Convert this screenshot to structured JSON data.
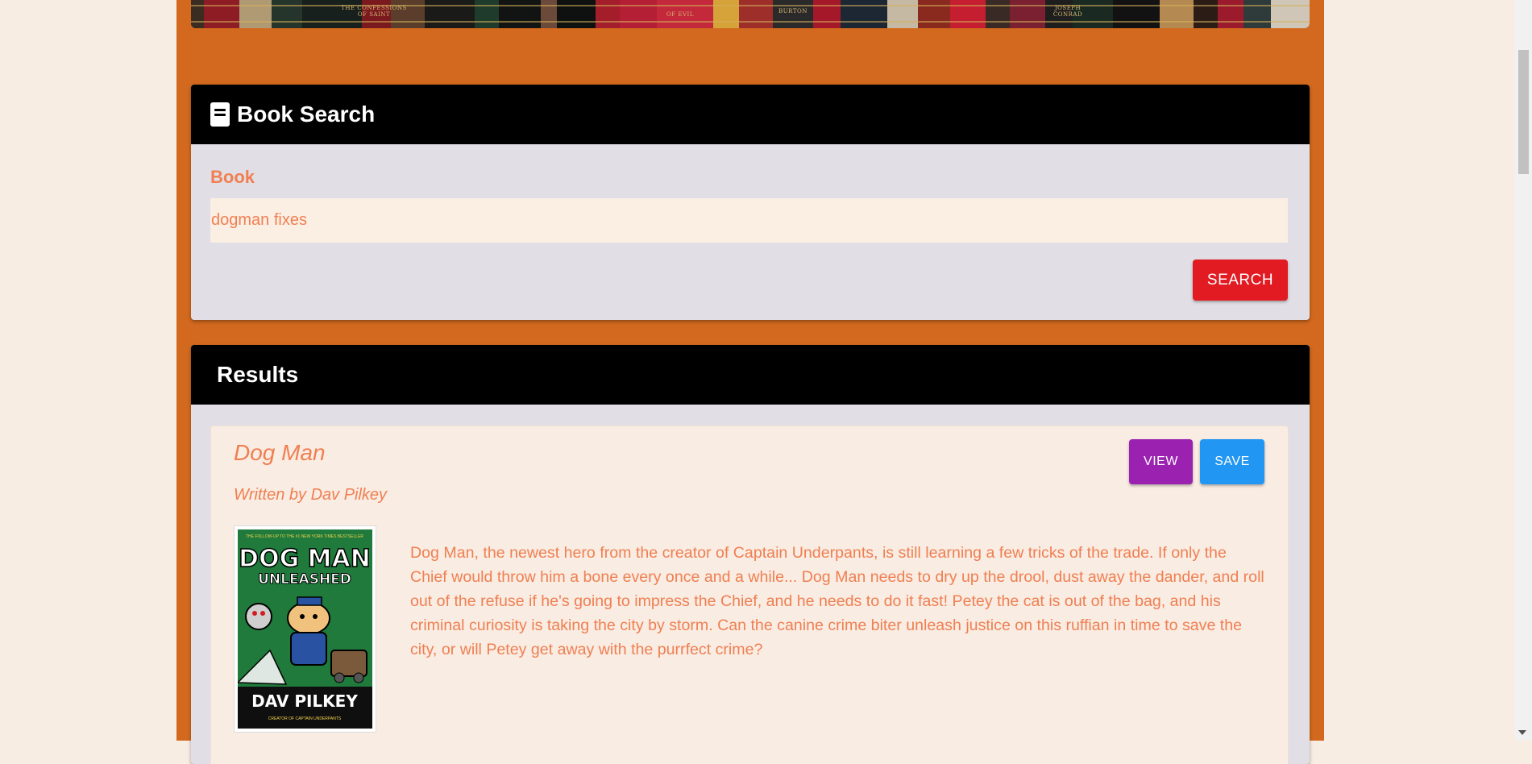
{
  "search": {
    "title": "Book Search",
    "field_label": "Book",
    "query_value": "dogman fixes",
    "button_label": "SEARCH"
  },
  "results": {
    "title": "Results",
    "items": [
      {
        "title": "Dog Man",
        "author_line": "Written by Dav Pilkey",
        "view_label": "VIEW",
        "save_label": "SAVE",
        "description": "Dog Man, the newest hero from the creator of Captain Underpants, is still learning a few tricks of the trade. If only the Chief would throw him a bone every once and a while... Dog Man needs to dry up the drool, dust away the dander, and roll out of the refuse if he's going to impress the Chief, and he needs to do it fast! Petey the cat is out of the bag, and his criminal curiosity is taking the city by storm. Can the canine crime biter unleash justice on this ruffian in time to save the city, or will Petey get away with the purrfect crime?",
        "cover": {
          "top_text": "THE FOLLOW-UP TO THE #1 NEW YORK TIMES BESTSELLER",
          "title_line1": "DOG MAN",
          "title_line2": "UNLEASHED",
          "author": "DAV PILKEY",
          "bottom_text": "CREATOR OF CAPTAIN UNDERPANTS"
        }
      }
    ]
  },
  "banner": {
    "spine_labels": [
      "THE CONFESSIONS OF SAINT",
      "OF EVIL",
      "BURTON",
      "JOSEPH CONRAD"
    ]
  },
  "colors": {
    "page_background": "#f8ede3",
    "frame": "#d2691e",
    "card": "#e1dfe5",
    "header": "#000000",
    "accent_text": "#f07f52",
    "search_button": "#e21b23",
    "view_button": "#9b22b1",
    "save_button": "#2196f3"
  },
  "icons": {
    "header_icon": "book-icon"
  }
}
